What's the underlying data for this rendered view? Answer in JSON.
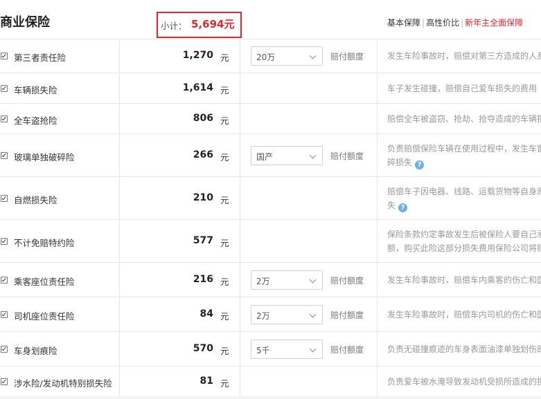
{
  "header": {
    "title": "商业保险",
    "subtotal_label": "小计：",
    "subtotal_value": "5,694元",
    "tabs": [
      "基本保障",
      "高性价比",
      "新年主全面保障"
    ]
  },
  "colors": {
    "accent": "#e0262d",
    "help_icon": "#6aaef0"
  },
  "limit_label": "赔付额度",
  "rows": [
    {
      "name": "第三者责任险",
      "price": "1,270",
      "unit": "元",
      "select": "20万",
      "desc1": "发生车险事故时，赔偿对第三方造成的人身",
      "desc2": ""
    },
    {
      "name": "车辆损失险",
      "price": "1,614",
      "unit": "元",
      "select": "",
      "desc1": "车子发生碰撞，赔偿自己爱车损失的费用",
      "desc2": ""
    },
    {
      "name": "全车盗抢险",
      "price": "806",
      "unit": "元",
      "select": "",
      "desc1": "赔偿全车被盗窃、抢劫、抢夺造成的车辆损",
      "desc2": ""
    },
    {
      "name": "玻璃单独破碎险",
      "price": "266",
      "unit": "元",
      "select": "国产",
      "desc1": "负责赔偿保险车辆在使用过程中，发生车窗",
      "desc2": "碎损失"
    },
    {
      "name": "自燃损失险",
      "price": "210",
      "unit": "元",
      "select": "",
      "desc1": "赔偿车子因电器、线路、运载货物等自身原",
      "desc2": "失"
    },
    {
      "name": "不计免赔特约险",
      "price": "577",
      "unit": "元",
      "select": "",
      "desc1": "保险条款约定事故发生后被保险人要自己承",
      "desc2": "额，购买此险这部分损失费用保险公司将赔"
    },
    {
      "name": "乘客座位责任险",
      "price": "216",
      "unit": "元",
      "select": "2万",
      "desc1": "发生车险事故时，赔偿车内乘客的伤亡和医",
      "desc2": ""
    },
    {
      "name": "司机座位责任险",
      "price": "84",
      "unit": "元",
      "select": "2万",
      "desc1": "发生车险事故时，赔偿车内司机的伤亡和医",
      "desc2": ""
    },
    {
      "name": "车身划痕险",
      "price": "570",
      "unit": "元",
      "select": "5千",
      "desc1": "负责无碰撞痕迹的车身表面油漆单独划伤的",
      "desc2": ""
    },
    {
      "name": "涉水险/发动机特别损失险",
      "price": "81",
      "unit": "元",
      "select": "",
      "desc1": "负责爱车被水淹导致发动机受损所造成的损",
      "desc2": ""
    }
  ]
}
